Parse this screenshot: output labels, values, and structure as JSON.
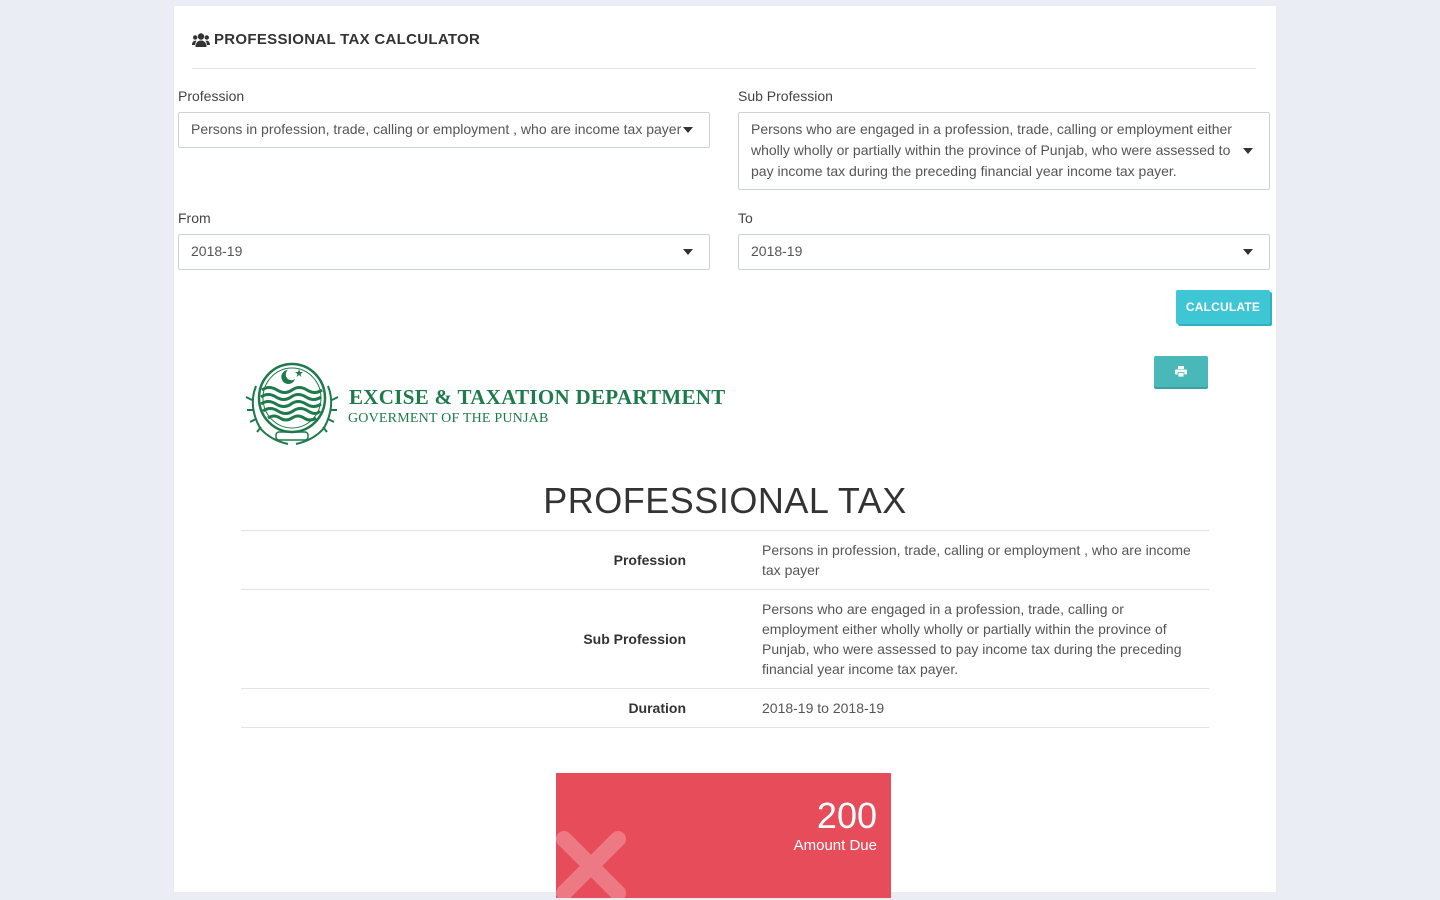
{
  "header": {
    "icon": "users-icon",
    "title": "PROFESSIONAL TAX CALCULATOR"
  },
  "form": {
    "profession_label": "Profession",
    "profession_value": "Persons in profession, trade, calling or employment , who are income tax payer",
    "sub_profession_label": "Sub Profession",
    "sub_profession_value": "Persons who are engaged in a profession, trade, calling or employment either wholly wholly or partially within the province of Punjab, who were assessed to pay income tax during the preceding financial year income tax payer.",
    "from_label": "From",
    "from_value": "2018-19",
    "to_label": "To",
    "to_value": "2018-19",
    "calculate_label": "CALCULATE"
  },
  "report": {
    "print_icon": "print-icon",
    "department_name": "EXCISE & TAXATION DEPARTMENT",
    "department_sub": "GOVERMENT OF THE PUNJAB",
    "title": "PROFESSIONAL TAX",
    "rows": [
      {
        "key": "Profession",
        "value": "Persons in profession, trade, calling or employment , who are income tax payer"
      },
      {
        "key": "Sub Profession",
        "value": "Persons who are engaged in a profession, trade, calling or employment either wholly wholly or partially within the province of Punjab, who were assessed to pay income tax during the preceding financial year income tax payer."
      },
      {
        "key": "Duration",
        "value": "2018-19 to 2018-19"
      }
    ],
    "amount_value": "200",
    "amount_label": "Amount Due"
  },
  "colors": {
    "accent_button": "#3ec6d4",
    "print_button": "#48b8b9",
    "amount_box": "#e74c5b",
    "brand_green": "#1e7a4a"
  }
}
